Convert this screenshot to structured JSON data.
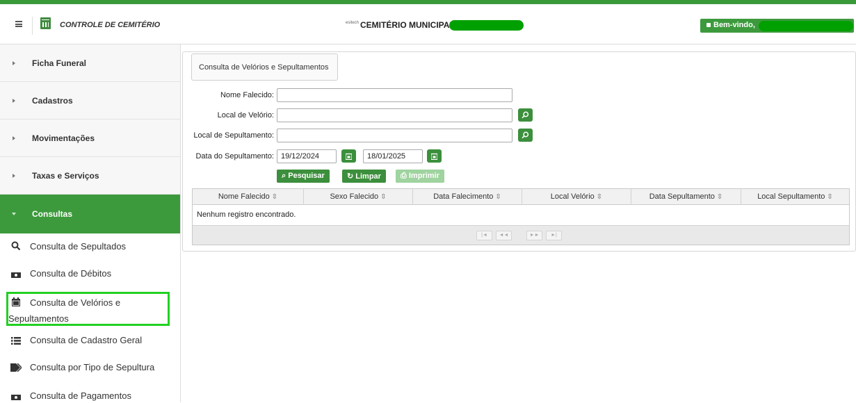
{
  "header": {
    "app_title": "CONTROLE DE CEMITÉRIO",
    "center_brand": "esitech",
    "center_title": "CEMITÉRIO MUNICIPAL",
    "welcome_label": "Bem-vindo,"
  },
  "sidebar": {
    "menu": [
      {
        "label": "Ficha Funeral",
        "active": false
      },
      {
        "label": "Cadastros",
        "active": false
      },
      {
        "label": "Movimentações",
        "active": false
      },
      {
        "label": "Taxas e Serviços",
        "active": false
      },
      {
        "label": "Consultas",
        "active": true
      }
    ],
    "submenu": [
      {
        "label": "Consulta de Sepultados",
        "icon": "search-icon"
      },
      {
        "label": "Consulta de Débitos",
        "icon": "money-icon"
      },
      {
        "label_line1": "Consulta de Velórios e",
        "label_line2": "Sepultamentos",
        "icon": "calendar-icon",
        "selected": true
      },
      {
        "label": "Consulta de Cadastro Geral",
        "icon": "list-icon"
      },
      {
        "label": "Consulta por Tipo de Sepultura",
        "icon": "tags-icon"
      },
      {
        "label": "Consulta de Pagamentos",
        "icon": "money-icon"
      }
    ]
  },
  "form": {
    "legend": "Consulta de Velórios e Sepultamentos",
    "nome_falecido_label": "Nome Falecido:",
    "nome_falecido_value": "",
    "local_velorio_label": "Local de Velório:",
    "local_velorio_value": "",
    "local_sepultamento_label": "Local de Sepultamento:",
    "local_sepultamento_value": "",
    "data_sepultamento_label": "Data do Sepultamento:",
    "data_inicio": "19/12/2024",
    "data_fim": "18/01/2025",
    "buttons": {
      "pesquisar": "Pesquisar",
      "limpar": "Limpar",
      "imprimir": "Imprimir"
    }
  },
  "grid": {
    "columns": [
      "Nome Falecido",
      "Sexo Falecido",
      "Data Falecimento",
      "Local Velório",
      "Data Sepultamento",
      "Local Sepultamento"
    ],
    "empty_message": "Nenhum registro encontrado.",
    "pager": [
      "|◄",
      "◄◄",
      "►►",
      "►|"
    ]
  },
  "colors": {
    "accent_green": "#3c9a3c",
    "highlight": "#22d022"
  }
}
